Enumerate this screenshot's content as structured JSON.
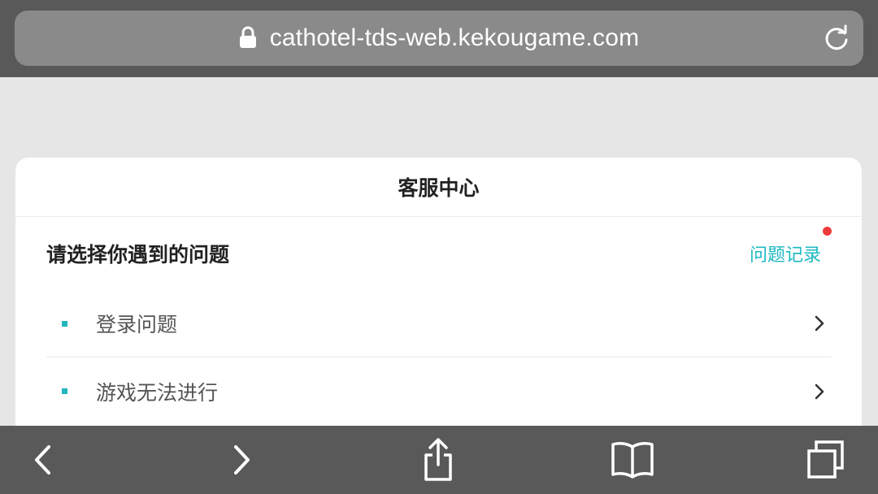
{
  "browser": {
    "url": "cathotel-tds-web.kekougame.com",
    "icons": {
      "lock": "lock-icon",
      "reload": "reload-icon"
    }
  },
  "page": {
    "title": "客服中心",
    "section_title": "请选择你遇到的问题",
    "history_link": "问题记录",
    "has_notification_dot": true,
    "items": [
      {
        "label": "登录问题"
      },
      {
        "label": "游戏无法进行"
      }
    ]
  },
  "toolbar": {
    "icons": [
      "back-icon",
      "forward-icon",
      "share-icon",
      "bookmarks-icon",
      "tabs-icon"
    ]
  },
  "colors": {
    "accent": "#1cb8c2",
    "notification": "#ef3b3b",
    "chrome": "#595959",
    "background": "#e6e6e6"
  }
}
